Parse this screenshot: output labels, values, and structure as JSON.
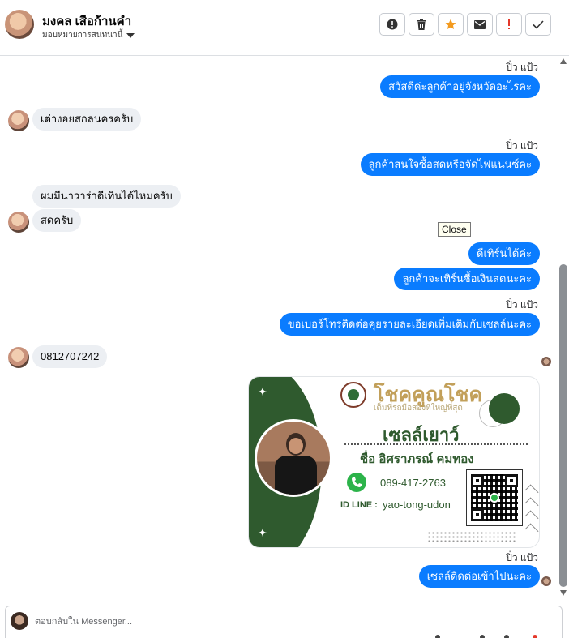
{
  "header": {
    "contact_name": "มงคล เสือก้านคำ",
    "assign_label": "มอบหมายการสนทนานี้",
    "tools": [
      {
        "icon": "alert-circle-icon",
        "name": "mark-spam-button"
      },
      {
        "icon": "trash-icon",
        "name": "delete-button"
      },
      {
        "icon": "star-icon",
        "name": "star-button",
        "color": "#f39a1e"
      },
      {
        "icon": "envelope-icon",
        "name": "mark-unread-button"
      },
      {
        "icon": "exclamation-icon",
        "name": "flag-button",
        "color": "#e4392b"
      },
      {
        "icon": "check-icon",
        "name": "done-button"
      }
    ]
  },
  "messages": {
    "sender_label": "ปิ่ว แป้ว",
    "m1": "สวัสดีค่ะลูกค้าอยู่จังหวัดอะไรคะ",
    "m2": "เต่างอยสกลนครครับ",
    "m3": "ลูกค้าสนใจซื้อสดหรือจัดไฟแนนซ์คะ",
    "m4": "ผมมีนาวาร่าดีเทินได้ไหมครับ",
    "m5": "สดครับ",
    "m6": "ดีเทิร์นได้ค่ะ",
    "m7": "ลูกค้าจะเทิร์นซื้อเงินสดนะคะ",
    "m8": "ขอเบอร์โทรติดต่อคุยรายละเอียดเพิ่มเติมกับเซลล์นะคะ",
    "m9": "0812707242",
    "m10": "เซลล์ติดต่อเข้าไปนะคะ"
  },
  "tooltip": "Close",
  "card": {
    "brand": "โชคคูณโชค",
    "tagline": "เต็มที่รถมือสองที่ใหญ่ที่สุด",
    "title": "เซลล์เยาว์",
    "name": "ชื่อ อิศราภรณ์ คมทอง",
    "phone": "089-417-2763",
    "line_label": "ID LINE :",
    "line_id": "yao-tong-udon",
    "green": "#2f5a2e"
  },
  "composer": {
    "placeholder": "ตอบกลับใน Messenger..."
  },
  "colors": {
    "outgoing_bubble": "#0a7cff",
    "incoming_bubble": "#eceff3"
  }
}
